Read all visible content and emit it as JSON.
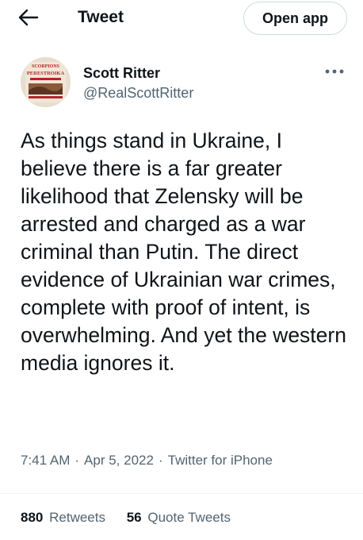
{
  "nav": {
    "title": "Tweet",
    "open_app_label": "Open app"
  },
  "author": {
    "display_name": "Scott Ritter",
    "handle": "@RealScottRitter",
    "avatar_text_top": "SCORPIONS",
    "avatar_text_mid": "PERESTROIKA"
  },
  "tweet": {
    "text": "As things stand in Ukraine, I believe there is a far greater likelihood that Zelensky will be arrested and charged as a war criminal than Putin. The direct evidence of Ukrainian war crimes, complete with proof of intent, is overwhelming. And yet the western media ignores it.",
    "time": "7:41 AM",
    "date": "Apr 5, 2022",
    "source": "Twitter for iPhone",
    "separator": "·"
  },
  "stats": {
    "retweets_count": "880",
    "retweets_label": "Retweets",
    "quotes_count": "56",
    "quotes_label": "Quote Tweets"
  },
  "colors": {
    "text_primary": "#0f1419",
    "text_secondary": "#536471",
    "border": "#cfd9de",
    "divider": "#eff3f4"
  },
  "icons": {
    "back": "arrow-left-icon",
    "more": "more-horizontal-icon"
  }
}
